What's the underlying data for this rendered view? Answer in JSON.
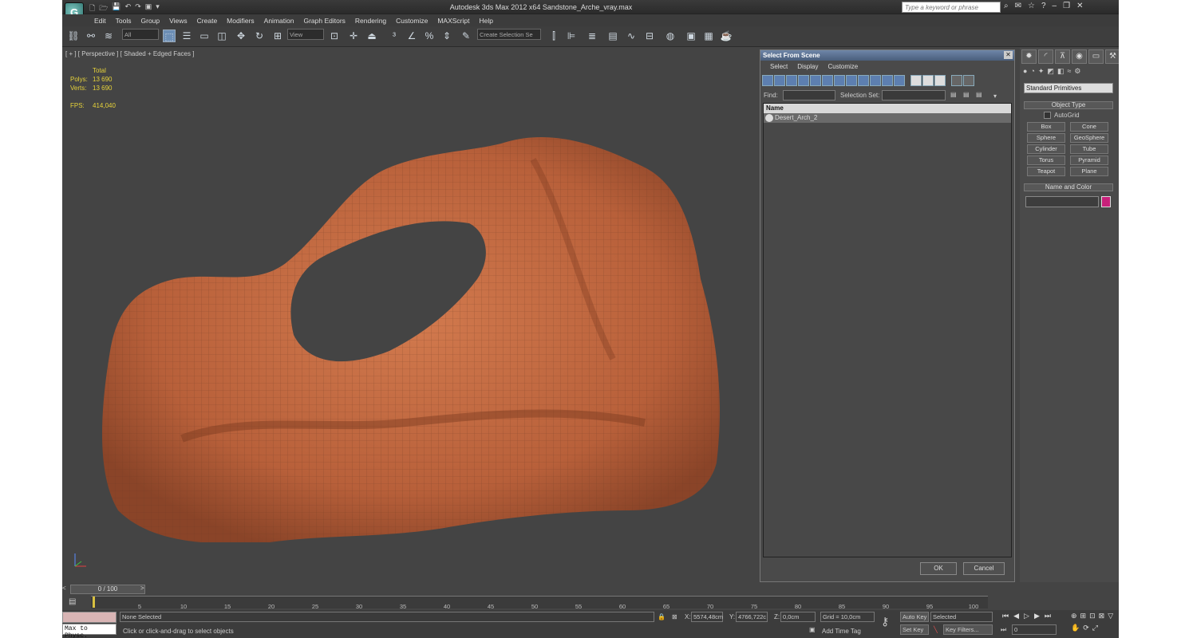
{
  "window": {
    "title": "Autodesk 3ds Max  2012 x64    Sandstone_Arche_vray.max",
    "help_search_placeholder": "Type a keyword or phrase",
    "logo": "G"
  },
  "menubar": [
    "Edit",
    "Tools",
    "Group",
    "Views",
    "Create",
    "Modifiers",
    "Animation",
    "Graph Editors",
    "Rendering",
    "Customize",
    "MAXScript",
    "Help"
  ],
  "toolbar": {
    "filter_dropdown": "All",
    "ref_coord_dropdown": "View",
    "selection_set_dropdown": "Create Selection Se"
  },
  "viewport": {
    "label": "[ + ] [ Perspective ] [ Shaded + Edged Faces ]",
    "stats": {
      "header": "Total",
      "polys_label": "Polys:",
      "polys_value": "13 690",
      "verts_label": "Verts:",
      "verts_value": "13 690",
      "fps_label": "FPS:",
      "fps_value": "414,040"
    }
  },
  "select_dialog": {
    "title": "Select From Scene",
    "menu": [
      "Select",
      "Display",
      "Customize"
    ],
    "find_label": "Find:",
    "selection_set_label": "Selection Set:",
    "column_name": "Name",
    "objects": [
      "Desert_Arch_2"
    ],
    "ok_label": "OK",
    "cancel_label": "Cancel"
  },
  "command_panel": {
    "category_dropdown": "Standard Primitives",
    "object_type_label": "Object Type",
    "autogrid_label": "AutoGrid",
    "primitives": [
      "Box",
      "Cone",
      "Sphere",
      "GeoSphere",
      "Cylinder",
      "Tube",
      "Torus",
      "Pyramid",
      "Teapot",
      "Plane"
    ],
    "name_color_label": "Name and Color",
    "object_color": "#c8207a"
  },
  "timeline": {
    "slider_label": "0 / 100",
    "ticks": [
      "5",
      "10",
      "15",
      "20",
      "25",
      "30",
      "35",
      "40",
      "45",
      "50",
      "55",
      "60",
      "65",
      "70",
      "75",
      "80",
      "85",
      "90",
      "95",
      "100"
    ]
  },
  "statusbar": {
    "maxscript_label": "Max to Physc.",
    "selection_status": "None Selected",
    "prompt": "Click or click-and-drag to select objects",
    "x_label": "X:",
    "x_value": "5574,48cm",
    "y_label": "Y:",
    "y_value": "4766,722c",
    "z_label": "Z:",
    "z_value": "0,0cm",
    "grid_label": "Grid = 10,0cm",
    "add_time_tag": "Add Time Tag",
    "auto_key": "Auto Key",
    "set_key": "Set Key",
    "key_mode_dropdown": "Selected",
    "key_filters": "Key Filters...",
    "frame_value": "0"
  }
}
